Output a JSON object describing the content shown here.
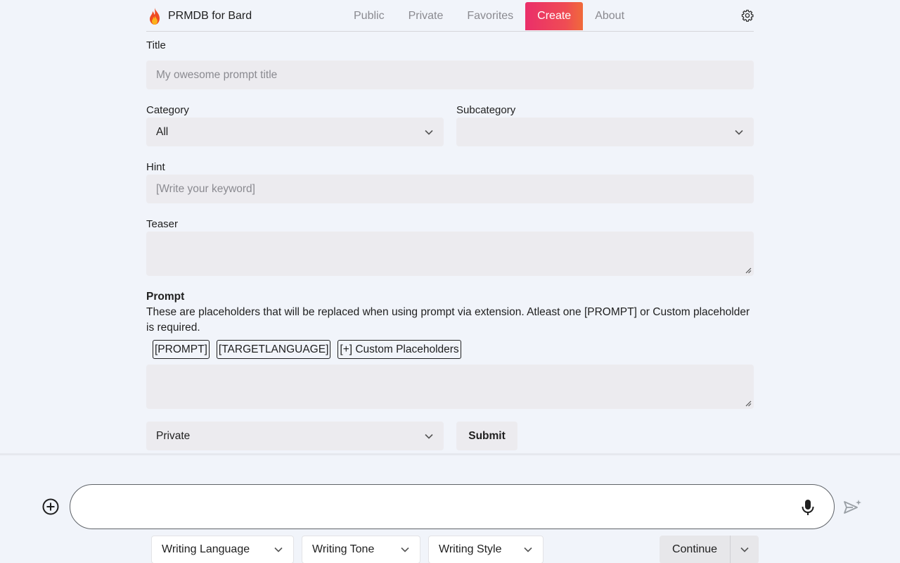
{
  "brand": {
    "name": "PRMDB for Bard",
    "icon": "flame-icon"
  },
  "nav": {
    "links": [
      "Public",
      "Private",
      "Favorites",
      "Create",
      "About"
    ],
    "active": "Create",
    "settings_icon": "gear-icon"
  },
  "form": {
    "title_label": "Title",
    "title_placeholder": "My owesome prompt title",
    "category_label": "Category",
    "category_value": "All",
    "subcategory_label": "Subcategory",
    "subcategory_value": "",
    "hint_label": "Hint",
    "hint_placeholder": "[Write your keyword]",
    "teaser_label": "Teaser",
    "prompt_label": "Prompt",
    "prompt_description": "These are placeholders that will be replaced when using prompt via extension. Atleast one [PROMPT] or Custom placeholder is required.",
    "placeholders": [
      "[PROMPT]",
      "[TARGETLANGUAGE]",
      "[+] Custom Placeholders"
    ],
    "visibility_value": "Private",
    "submit_label": "Submit"
  },
  "chatbar": {
    "add_icon": "add-circle-icon",
    "mic_icon": "mic-icon",
    "send_icon": "send-icon",
    "writing_language": "Writing Language",
    "writing_tone": "Writing Tone",
    "writing_style": "Writing Style",
    "continue_label": "Continue"
  },
  "colors": {
    "accent_gradient_start": "#ea2f6a",
    "accent_gradient_end": "#f06a3a",
    "field_bg": "#ecebef",
    "page_bg": "#f1f4fa"
  }
}
